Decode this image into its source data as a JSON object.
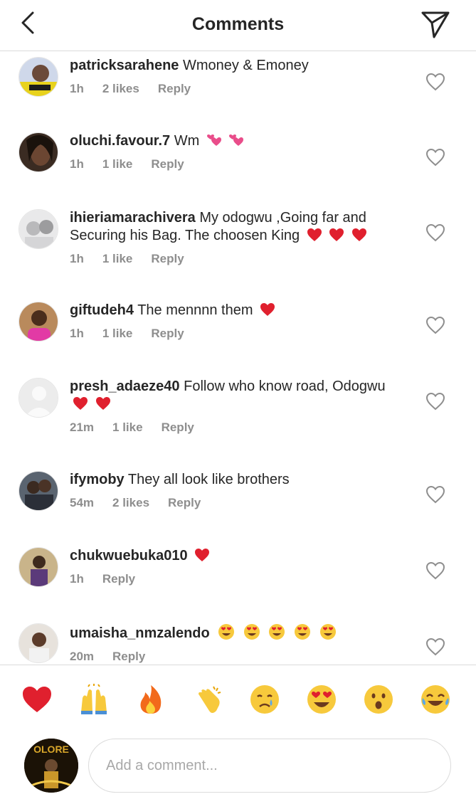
{
  "header": {
    "title": "Comments",
    "back_icon": "chevron-left-icon",
    "send_icon": "paper-plane-icon"
  },
  "comments": [
    {
      "username": "patricksarahene",
      "text": "Wmoney & Emoney",
      "time": "1h",
      "likes": "2 likes",
      "reply": "Reply",
      "emojis": []
    },
    {
      "username": "oluchi.favour.7",
      "text": "Wm",
      "time": "1h",
      "likes": "1 like",
      "reply": "Reply",
      "emojis": [
        "two-hearts",
        "two-hearts"
      ]
    },
    {
      "username": "ihieriamarachivera",
      "text": "My odogwu ,Going far and Securing his Bag. The choosen King",
      "time": "1h",
      "likes": "1 like",
      "reply": "Reply",
      "emojis": [
        "red-heart",
        "red-heart",
        "red-heart"
      ]
    },
    {
      "username": "giftudeh4",
      "text": "The mennnn them",
      "time": "1h",
      "likes": "1 like",
      "reply": "Reply",
      "emojis": [
        "red-heart"
      ]
    },
    {
      "username": "presh_adaeze40",
      "text": "Follow who know road, Odogwu",
      "time": "21m",
      "likes": "1 like",
      "reply": "Reply",
      "emojis": [
        "red-heart",
        "red-heart"
      ]
    },
    {
      "username": "ifymoby",
      "text": "They all look like brothers",
      "time": "54m",
      "likes": "2 likes",
      "reply": "Reply",
      "emojis": []
    },
    {
      "username": "chukwuebuka010",
      "text": "",
      "time": "1h",
      "likes": "",
      "reply": "Reply",
      "emojis": [
        "red-heart"
      ]
    },
    {
      "username": "umaisha_nmzalendo",
      "text": "",
      "time": "20m",
      "likes": "",
      "reply": "Reply",
      "emojis": [
        "heart-eyes",
        "heart-eyes",
        "heart-eyes",
        "heart-eyes",
        "heart-eyes"
      ]
    }
  ],
  "reactions": [
    "red-heart-emoji",
    "raising-hands-emoji",
    "fire-emoji",
    "clapping-hands-emoji",
    "crying-face-emoji",
    "heart-eyes-emoji",
    "surprised-face-emoji",
    "tears-of-joy-emoji"
  ],
  "composer": {
    "placeholder": "Add a comment...",
    "avatar_text": "OLORE"
  },
  "colors": {
    "text": "#262626",
    "meta": "#8e8e8e",
    "border": "#dbdbdb",
    "heart_red": "#e0202e"
  }
}
